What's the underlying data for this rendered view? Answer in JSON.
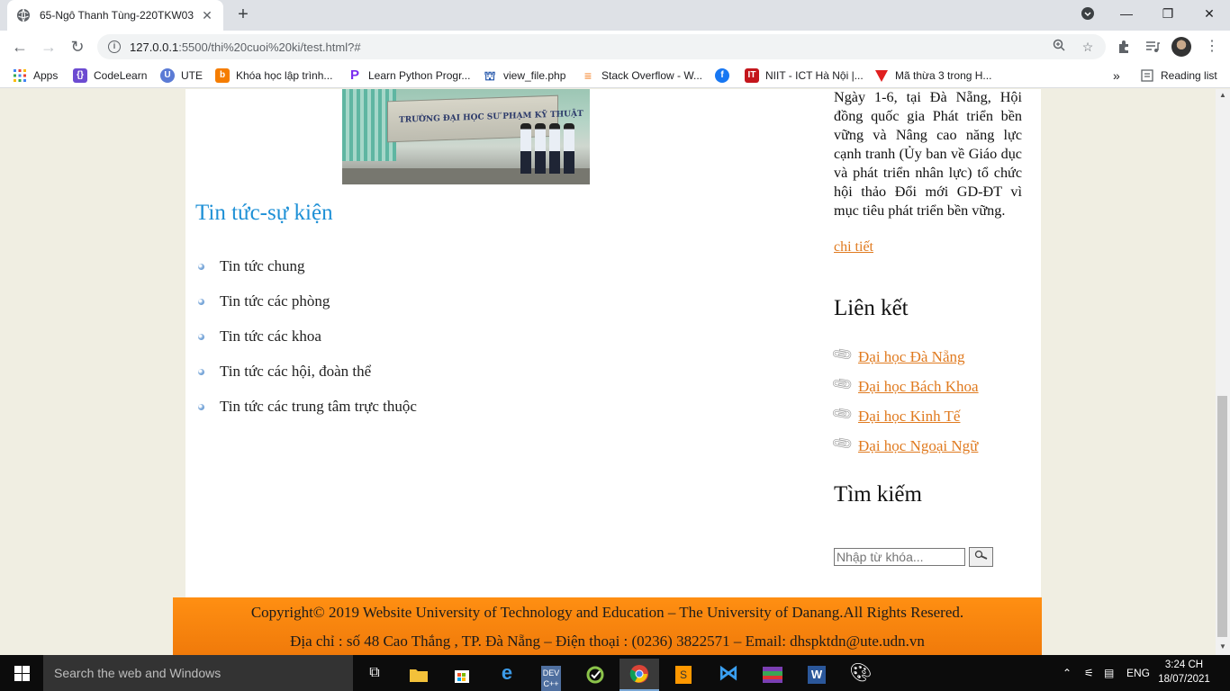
{
  "browser": {
    "tab_title": "65-Ngô Thanh Tùng-220TKW03",
    "url_host": "127.0.0.1",
    "url_path": ":5500/thi%20cuoi%20ki/test.html?#",
    "bookmarks": [
      {
        "label": "Apps",
        "icon": "apps-grid-icon",
        "color": "#4285f4"
      },
      {
        "label": "CodeLearn",
        "icon": "codelearn-icon",
        "color": "#6c4bd1"
      },
      {
        "label": "UTE",
        "icon": "ute-icon",
        "color": "#5b7bd5"
      },
      {
        "label": "Khóa học lập trình...",
        "icon": "blogger-b-icon",
        "color": "#f57d00"
      },
      {
        "label": "Learn Python Progr...",
        "icon": "python-p-icon",
        "color": "#7a2cf0"
      },
      {
        "label": "view_file.php",
        "icon": "view-file-icon",
        "color": "#2255aa"
      },
      {
        "label": "Stack Overflow - W...",
        "icon": "stackoverflow-icon",
        "color": "#f48024"
      },
      {
        "label": "",
        "icon": "facebook-icon",
        "color": "#1877f2"
      },
      {
        "label": "NIIT - ICT Hà Nội |...",
        "icon": "niit-icon",
        "color": "#c4161c"
      },
      {
        "label": "Mã thừa 3 trong H...",
        "icon": "v-logo-icon",
        "color": "#e02020"
      }
    ],
    "reading_list": "Reading list",
    "overflow": "»"
  },
  "page": {
    "photo_sign": "TRƯỜNG ĐẠI HỌC SƯ PHẠM KỸ THUẬT",
    "news_title": "Tin tức-sự kiện",
    "news_items": [
      "Tin tức chung",
      "Tin tức các phòng",
      "Tin tức các khoa",
      "Tin tức các hội, đoàn thể",
      "Tin tức các trung tâm trực thuộc"
    ],
    "side_paragraph": "Ngày 1-6, tại Đà Nẵng, Hội đồng quốc gia Phát triển bền vững và Nâng cao năng lực cạnh tranh (Ủy ban về Giáo dục và phát triển nhân lực) tổ chức hội thảo Đổi mới GD-ĐT vì mục tiêu phát triển bền vững.",
    "side_more": "chi tiết",
    "links_title": "Liên kết",
    "links": [
      "Đại học Đà Nẵng",
      "Đại học Bách Khoa",
      "Đại học Kinh Tế",
      "Đại học Ngoại Ngữ"
    ],
    "search_title": "Tìm kiếm",
    "search_placeholder": "Nhập từ khóa...",
    "footer_line1": "Copyright© 2019 Website University of Technology and Education – The University of Danang.All Rights Resered.",
    "footer_line2": "Địa chỉ : số 48 Cao Thắng , TP. Đà Nẵng – Điện thoại : (0236) 3822571 – Email: dhspktdn@ute.udn.vn"
  },
  "taskbar": {
    "search_placeholder": "Search the web and Windows",
    "lang": "ENG",
    "time": "3:24 CH",
    "date": "18/07/2021"
  },
  "colors": {
    "link_orange": "#e07a1f",
    "title_blue": "#1e90d6",
    "footer_orange": "#ff8f12"
  }
}
